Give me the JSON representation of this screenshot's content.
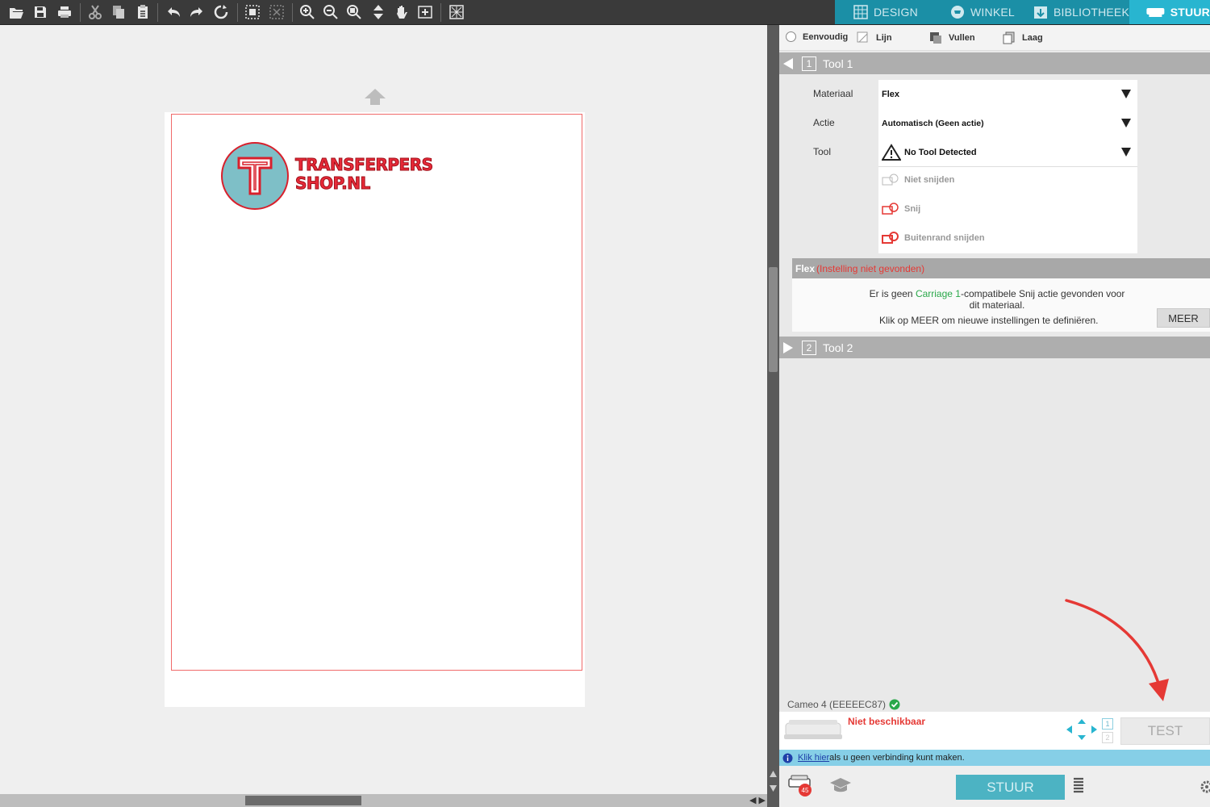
{
  "mode_tabs": {
    "design": "DESIGN",
    "winkel": "WINKEL",
    "bibliotheek": "BIBLIOTHEEK",
    "stuur": "STUUR"
  },
  "sub_tabs": {
    "eenvoudig": "Eenvoudig",
    "lijn": "Lijn",
    "vullen": "Vullen",
    "laag": "Laag"
  },
  "canvas": {
    "logo_line1": "TRANSFERPERS",
    "logo_line2": "SHOP.NL"
  },
  "tool1": {
    "title": "Tool 1",
    "number": "1",
    "labels": {
      "materiaal": "Materiaal",
      "actie": "Actie",
      "tool": "Tool"
    },
    "materiaal_value": "Flex",
    "actie_value": "Automatisch (Geen actie)",
    "tool_value": "No Tool Detected",
    "cut_options": [
      "Niet snijden",
      "Snij",
      "Buitenrand snijden"
    ]
  },
  "flex_warning": {
    "material": "Flex",
    "status": "(Instelling niet gevonden)",
    "line1_pre": "Er is geen ",
    "line1_link": "Carriage 1",
    "line1_post": "-compatibele Snij actie gevonden voor",
    "line2": "dit materiaal.",
    "line3": "Klik op MEER om nieuwe instellingen te definiëren.",
    "meer_button": "MEER"
  },
  "tool2": {
    "title": "Tool 2",
    "number": "2"
  },
  "device": {
    "name": "Cameo 4 (EEEEEC87)",
    "status": "Niet beschikbaar",
    "test_button": "TEST",
    "carriage_1": "1",
    "carriage_2": "2",
    "info_link": "Klik hier",
    "info_text": " als u geen verbinding kunt maken.",
    "send_button": "STUUR",
    "job_count": "45"
  },
  "colors": {
    "accent": "#28b5d0",
    "warning_red": "#e53935",
    "carriage_green": "#2aa84a",
    "logo_red": "#e72a38",
    "logo_teal": "#7ebfc7"
  }
}
